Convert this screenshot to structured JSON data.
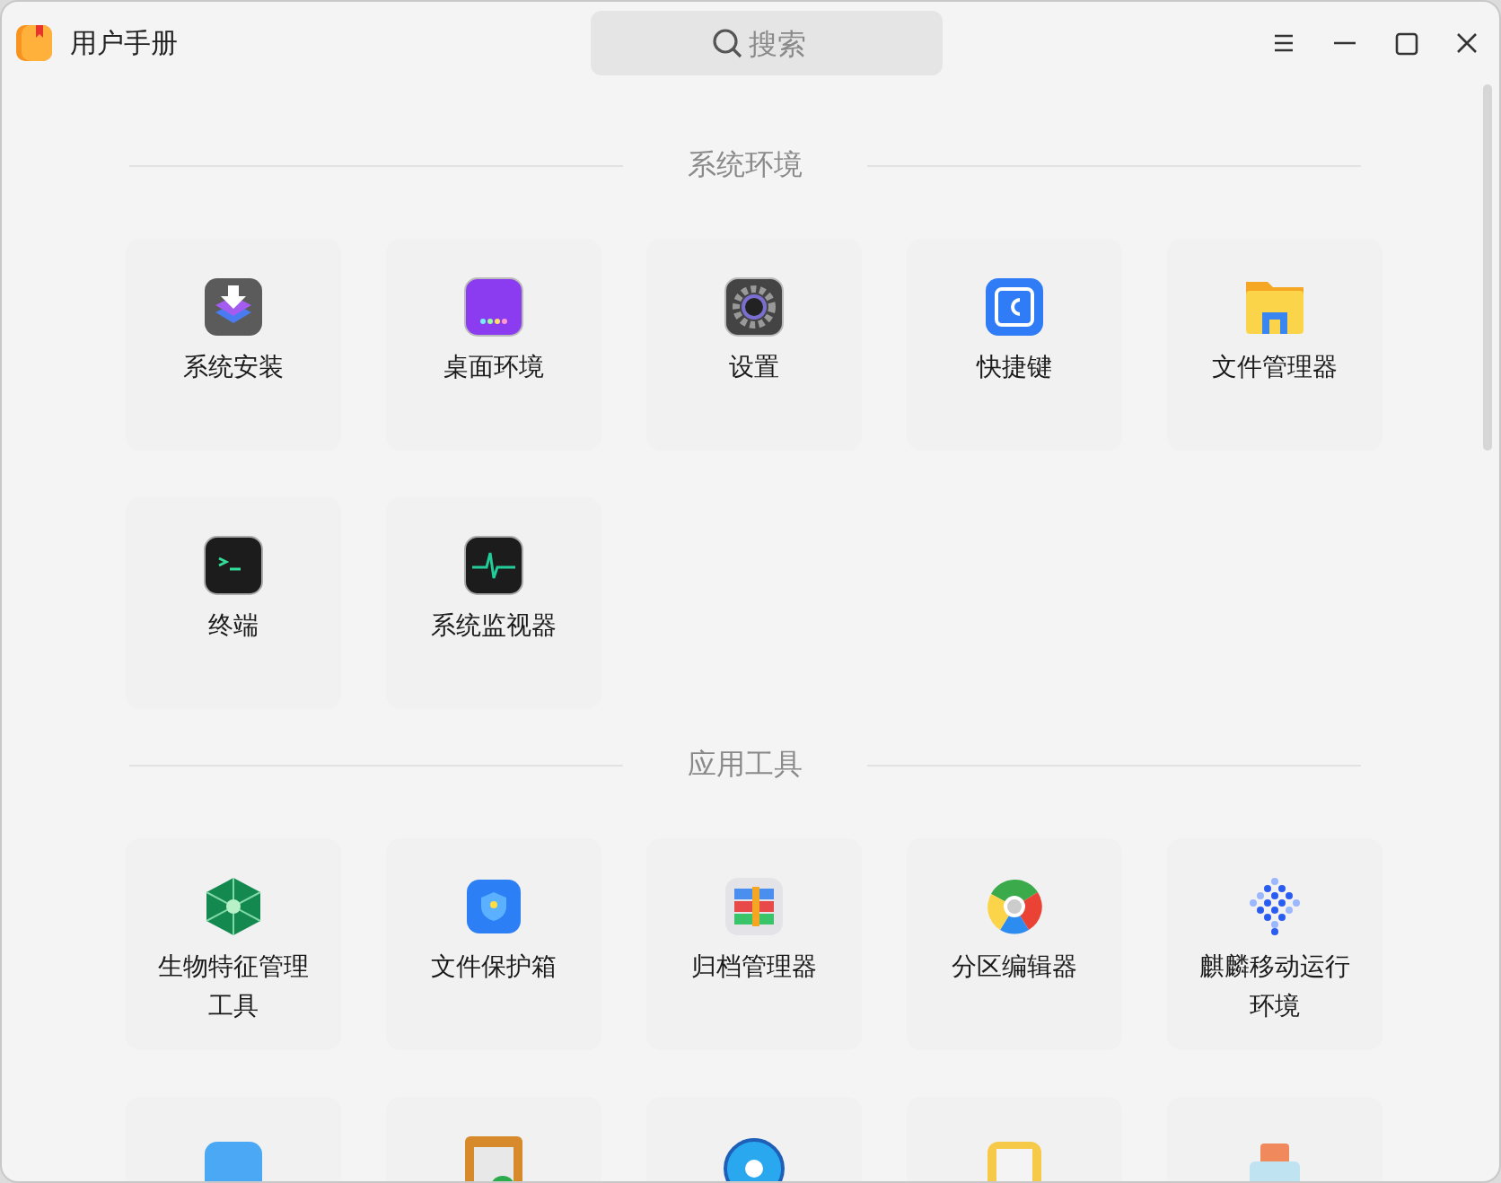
{
  "window": {
    "title": "用户手册"
  },
  "search": {
    "placeholder": "搜索"
  },
  "sections": [
    {
      "title": "系统环境",
      "items": [
        {
          "kind": "install",
          "label": "系统安装"
        },
        {
          "kind": "desktop",
          "label": "桌面环境"
        },
        {
          "kind": "settings",
          "label": "设置"
        },
        {
          "kind": "shortcut",
          "label": "快捷键"
        },
        {
          "kind": "files",
          "label": "文件管理器"
        },
        {
          "kind": "terminal",
          "label": "终端"
        },
        {
          "kind": "monitor",
          "label": "系统监视器"
        }
      ]
    },
    {
      "title": "应用工具",
      "items": [
        {
          "kind": "biometric",
          "label": "生物特征管理工具"
        },
        {
          "kind": "safebox",
          "label": "文件保护箱"
        },
        {
          "kind": "archive",
          "label": "归档管理器"
        },
        {
          "kind": "partition",
          "label": "分区编辑器"
        },
        {
          "kind": "dots",
          "label": "麒麟移动运行环境"
        },
        {
          "kind": "shield"
        },
        {
          "kind": "picture"
        },
        {
          "kind": "disc"
        },
        {
          "kind": "note"
        },
        {
          "kind": "printer"
        }
      ]
    }
  ]
}
